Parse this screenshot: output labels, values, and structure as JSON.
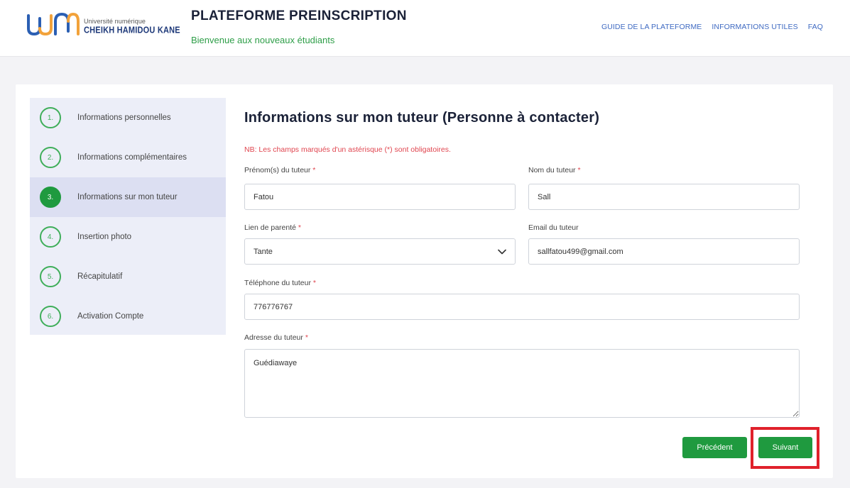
{
  "header": {
    "logo": {
      "line1": "Université numérique",
      "line2": "CHEIKH HAMIDOU KANE"
    },
    "title": "PLATEFORME PREINSCRIPTION",
    "subtitle": "Bienvenue aux nouveaux étudiants",
    "nav": [
      "GUIDE DE LA PLATEFORME",
      "INFORMATIONS UTILES",
      "FAQ"
    ]
  },
  "steps": [
    {
      "num": "1.",
      "label": "Informations personnelles"
    },
    {
      "num": "2.",
      "label": "Informations complémentaires"
    },
    {
      "num": "3.",
      "label": "Informations sur mon tuteur"
    },
    {
      "num": "4.",
      "label": "Insertion photo"
    },
    {
      "num": "5.",
      "label": "Récapitulatif"
    },
    {
      "num": "6.",
      "label": "Activation Compte"
    }
  ],
  "form": {
    "title": "Informations sur mon tuteur (Personne à contacter)",
    "note": "NB: Les champs marqués d'un astérisque (*) sont obligatoires.",
    "fields": {
      "prenom": {
        "label": "Prénom(s) du tuteur",
        "value": "Fatou"
      },
      "nom": {
        "label": "Nom du tuteur",
        "value": "Sall"
      },
      "lien": {
        "label": "Lien de parenté",
        "value": "Tante"
      },
      "email": {
        "label": "Email du tuteur",
        "value": "sallfatou499@gmail.com"
      },
      "telephone": {
        "label": "Téléphone du tuteur",
        "value": "776776767"
      },
      "adresse": {
        "label": "Adresse du tuteur",
        "value": "Guédiawaye"
      }
    },
    "required_mark": "*",
    "buttons": {
      "previous": "Précédent",
      "next": "Suivant"
    }
  },
  "colors": {
    "accent": "#1f9a3f",
    "required": "#e0454f",
    "highlight": "#e0212b",
    "nav": "#3f6ac2"
  }
}
